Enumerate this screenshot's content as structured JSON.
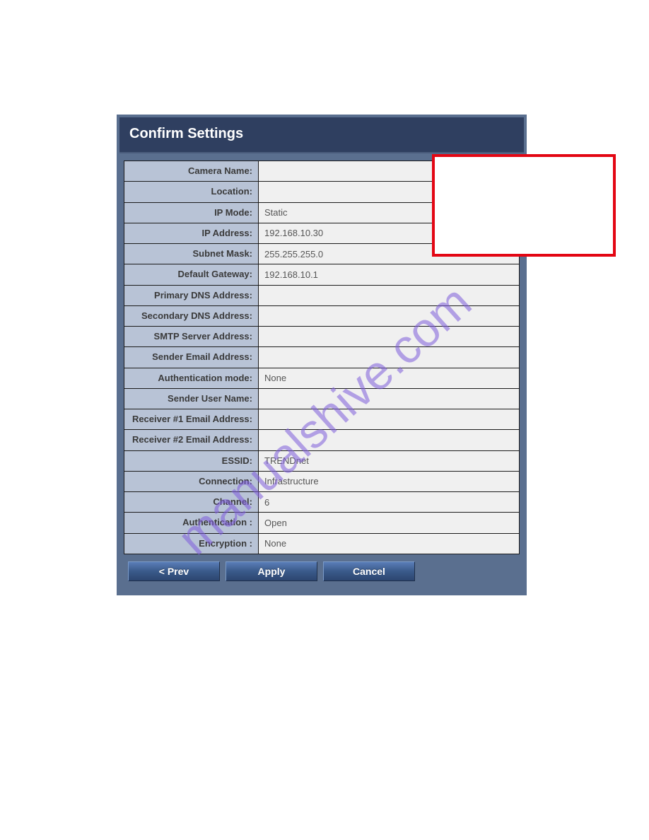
{
  "header": {
    "title": "Confirm Settings"
  },
  "rows": [
    {
      "label": "Camera Name:",
      "value": ""
    },
    {
      "label": "Location:",
      "value": ""
    },
    {
      "label": "IP Mode:",
      "value": "Static"
    },
    {
      "label": "IP Address:",
      "value": "192.168.10.30"
    },
    {
      "label": "Subnet Mask:",
      "value": "255.255.255.0"
    },
    {
      "label": "Default Gateway:",
      "value": "192.168.10.1"
    },
    {
      "label": "Primary DNS Address:",
      "value": ""
    },
    {
      "label": "Secondary DNS Address:",
      "value": ""
    },
    {
      "label": "SMTP Server Address:",
      "value": ""
    },
    {
      "label": "Sender Email Address:",
      "value": ""
    },
    {
      "label": "Authentication mode:",
      "value": "None"
    },
    {
      "label": "Sender User Name:",
      "value": ""
    },
    {
      "label": "Receiver #1 Email Address:",
      "value": ""
    },
    {
      "label": "Receiver #2 Email Address:",
      "value": ""
    },
    {
      "label": "ESSID:",
      "value": "TRENDnet"
    },
    {
      "label": "Connection:",
      "value": "Infrastructure"
    },
    {
      "label": "Channel:",
      "value": "6"
    },
    {
      "label": "Authentication :",
      "value": "Open"
    },
    {
      "label": "Encryption :",
      "value": "None"
    }
  ],
  "buttons": {
    "prev": "< Prev",
    "apply": "Apply",
    "cancel": "Cancel"
  },
  "watermark": "manualshive.com"
}
